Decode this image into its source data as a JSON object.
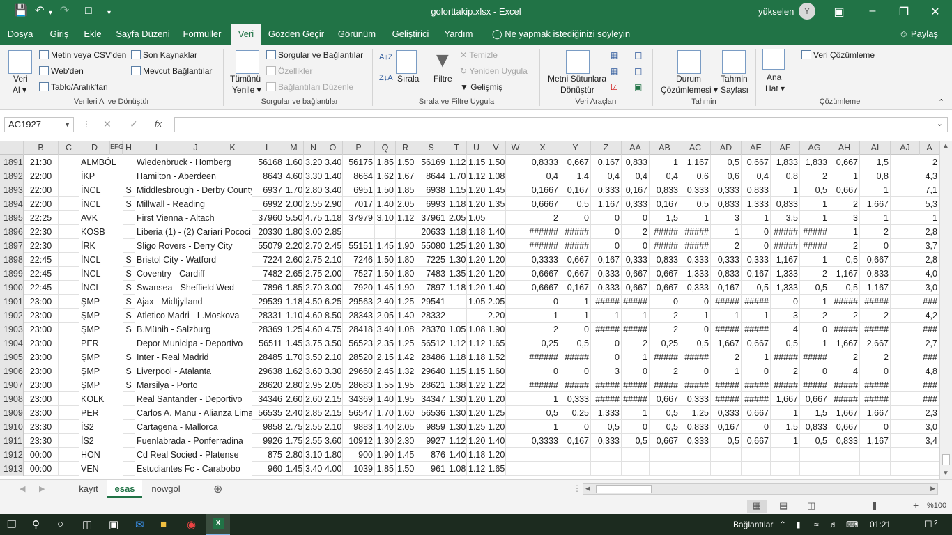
{
  "window": {
    "title": "golorttakip.xlsx  -  Excel",
    "user": "yükselen",
    "avatar_letter": "Y"
  },
  "tabs": [
    "Dosya",
    "Giriş",
    "Ekle",
    "Sayfa Düzeni",
    "Formüller",
    "Veri",
    "Gözden Geçir",
    "Görünüm",
    "Geliştirici",
    "Yardım"
  ],
  "active_tab": "Veri",
  "tell_me": "Ne yapmak istediğinizi söyleyin",
  "share": "Paylaş",
  "ribbon": {
    "get_data": "Veri",
    "get_data2": "Al",
    "from_csv": "Metin veya CSV'den",
    "from_web": "Web'den",
    "from_table": "Tablo/Aralık'tan",
    "recent_sources": "Son Kaynaklar",
    "existing_conn": "Mevcut Bağlantılar",
    "group_get": "Verileri Al ve Dönüştür",
    "refresh_all": "Tümünü",
    "refresh_all2": "Yenile",
    "queries_conn": "Sorgular ve Bağlantılar",
    "properties": "Özellikler",
    "edit_links": "Bağlantıları Düzenle",
    "group_queries": "Sorgular ve bağlantılar",
    "sort": "Sırala",
    "filter": "Filtre",
    "clear": "Temizle",
    "reapply": "Yeniden Uygula",
    "advanced": "Gelişmiş",
    "group_sort": "Sırala ve Filtre Uygula",
    "text_to_columns": "Metni Sütunlara",
    "text_to_columns2": "Dönüştür",
    "group_tools": "Veri Araçları",
    "what_if": "Durum",
    "what_if2": "Çözümlemesi",
    "forecast": "Tahmin",
    "forecast2": "Sayfası",
    "group_forecast": "Tahmin",
    "outline": "Ana",
    "outline2": "Hat",
    "data_analysis": "Veri Çözümleme",
    "group_analysis": "Çözümleme"
  },
  "name_box": "AC1927",
  "columns": [
    "B",
    "C",
    "D",
    "E",
    "F",
    "G",
    "H",
    "I",
    "J",
    "K",
    "L",
    "M",
    "N",
    "O",
    "P",
    "Q",
    "R",
    "S",
    "T",
    "U",
    "V",
    "W",
    "X",
    "Y",
    "Z",
    "AA",
    "AB",
    "AC",
    "AD",
    "AE",
    "AF",
    "AG",
    "AH",
    "AI",
    "AJ",
    "A"
  ],
  "rows": [
    {
      "n": "1891",
      "B": "21:30",
      "D": "ALMBÖL",
      "H": "",
      "I": "Wiedenbruck - Homberg",
      "L": "56168",
      "M": "1.60",
      "N": "3.20",
      "O": "3.40",
      "P": "56175",
      "Q": "1.85",
      "R": "1.50",
      "S": "56169",
      "T": "1.12",
      "U": "1.15",
      "V": "1.50",
      "X": "0,8333",
      "Y": "0,667",
      "Z": "0,167",
      "AA": "0,833",
      "AB": "1",
      "AC": "1,167",
      "AD": "0,5",
      "AE": "0,667",
      "AF": "1,833",
      "AG": "1,833",
      "AH": "0,667",
      "AI": "1,5",
      "A": "2"
    },
    {
      "n": "1892",
      "B": "22:00",
      "D": "İKP",
      "H": "",
      "I": "Hamilton - Aberdeen",
      "L": "8643",
      "M": "4.60",
      "N": "3.30",
      "O": "1.40",
      "P": "8664",
      "Q": "1.62",
      "R": "1.67",
      "S": "8644",
      "T": "1.70",
      "U": "1.12",
      "V": "1.08",
      "X": "0,4",
      "Y": "1,4",
      "Z": "0,4",
      "AA": "0,4",
      "AB": "0,4",
      "AC": "0,6",
      "AD": "0,6",
      "AE": "0,4",
      "AF": "0,8",
      "AG": "2",
      "AH": "1",
      "AI": "0,8",
      "A": "4,3"
    },
    {
      "n": "1893",
      "B": "22:00",
      "D": "İNCL",
      "H": "S",
      "I": "Middlesbrough - Derby County",
      "L": "6937",
      "M": "1.70",
      "N": "2.80",
      "O": "3.40",
      "P": "6951",
      "Q": "1.50",
      "R": "1.85",
      "S": "6938",
      "T": "1.15",
      "U": "1.20",
      "V": "1.45",
      "X": "0,1667",
      "Y": "0,167",
      "Z": "0,333",
      "AA": "0,167",
      "AB": "0,833",
      "AC": "0,333",
      "AD": "0,333",
      "AE": "0,833",
      "AF": "1",
      "AG": "0,5",
      "AH": "0,667",
      "AI": "1",
      "A": "7,1"
    },
    {
      "n": "1894",
      "B": "22:00",
      "D": "İNCL",
      "H": "S",
      "I": "Millwall - Reading",
      "L": "6992",
      "M": "2.00",
      "N": "2.55",
      "O": "2.90",
      "P": "7017",
      "Q": "1.40",
      "R": "2.05",
      "S": "6993",
      "T": "1.18",
      "U": "1.20",
      "V": "1.35",
      "X": "0,6667",
      "Y": "0,5",
      "Z": "1,167",
      "AA": "0,333",
      "AB": "0,167",
      "AC": "0,5",
      "AD": "0,833",
      "AE": "1,333",
      "AF": "0,833",
      "AG": "1",
      "AH": "2",
      "AI": "1,667",
      "A": "5,3"
    },
    {
      "n": "1895",
      "B": "22:25",
      "D": "AVK",
      "H": "",
      "I": "First Vienna - Altach",
      "L": "37960",
      "M": "5.50",
      "N": "4.75",
      "O": "1.18",
      "P": "37979",
      "Q": "3.10",
      "R": "1.12",
      "S": "37961",
      "T": "2.05",
      "U": "1.05",
      "V": "",
      "X": "2",
      "Y": "0",
      "Z": "0",
      "AA": "0",
      "AB": "1,5",
      "AC": "1",
      "AD": "3",
      "AE": "1",
      "AF": "3,5",
      "AG": "1",
      "AH": "3",
      "AI": "1",
      "A": "1"
    },
    {
      "n": "1896",
      "B": "22:30",
      "D": "KOSB",
      "H": "",
      "I": "Liberia (1) - (2) Cariari Pococi",
      "L": "20330",
      "M": "1.80",
      "N": "3.00",
      "O": "2.85",
      "P": "",
      "Q": "",
      "R": "",
      "S": "20633",
      "T": "1.18",
      "U": "1.18",
      "V": "1.40",
      "X": "######",
      "Y": "#####",
      "Z": "0",
      "AA": "2",
      "AB": "#####",
      "AC": "#####",
      "AD": "1",
      "AE": "0",
      "AF": "#####",
      "AG": "#####",
      "AH": "1",
      "AI": "2",
      "A": "2,8"
    },
    {
      "n": "1897",
      "B": "22:30",
      "D": "İRK",
      "H": "",
      "I": "Sligo Rovers - Derry City",
      "L": "55079",
      "M": "2.20",
      "N": "2.70",
      "O": "2.45",
      "P": "55151",
      "Q": "1.45",
      "R": "1.90",
      "S": "55080",
      "T": "1.25",
      "U": "1.20",
      "V": "1.30",
      "X": "######",
      "Y": "#####",
      "Z": "0",
      "AA": "0",
      "AB": "#####",
      "AC": "#####",
      "AD": "2",
      "AE": "0",
      "AF": "#####",
      "AG": "#####",
      "AH": "2",
      "AI": "0",
      "A": "3,7"
    },
    {
      "n": "1898",
      "B": "22:45",
      "D": "İNCL",
      "H": "S",
      "I": "Bristol City - Watford",
      "L": "7224",
      "M": "2.60",
      "N": "2.75",
      "O": "2.10",
      "P": "7246",
      "Q": "1.50",
      "R": "1.80",
      "S": "7225",
      "T": "1.30",
      "U": "1.20",
      "V": "1.20",
      "X": "0,3333",
      "Y": "0,667",
      "Z": "0,167",
      "AA": "0,333",
      "AB": "0,833",
      "AC": "0,333",
      "AD": "0,333",
      "AE": "0,333",
      "AF": "1,167",
      "AG": "1",
      "AH": "0,5",
      "AI": "0,667",
      "A": "2,8"
    },
    {
      "n": "1899",
      "B": "22:45",
      "D": "İNCL",
      "H": "S",
      "I": "Coventry - Cardiff",
      "L": "7482",
      "M": "2.65",
      "N": "2.75",
      "O": "2.00",
      "P": "7527",
      "Q": "1.50",
      "R": "1.80",
      "S": "7483",
      "T": "1.35",
      "U": "1.20",
      "V": "1.20",
      "X": "0,6667",
      "Y": "0,667",
      "Z": "0,333",
      "AA": "0,667",
      "AB": "0,667",
      "AC": "1,333",
      "AD": "0,833",
      "AE": "0,167",
      "AF": "1,333",
      "AG": "2",
      "AH": "1,167",
      "AI": "0,833",
      "A": "4,0"
    },
    {
      "n": "1900",
      "B": "22:45",
      "D": "İNCL",
      "H": "S",
      "I": "Swansea - Sheffield Wed",
      "L": "7896",
      "M": "1.85",
      "N": "2.70",
      "O": "3.00",
      "P": "7920",
      "Q": "1.45",
      "R": "1.90",
      "S": "7897",
      "T": "1.18",
      "U": "1.20",
      "V": "1.40",
      "X": "0,6667",
      "Y": "0,167",
      "Z": "0,333",
      "AA": "0,667",
      "AB": "0,667",
      "AC": "0,333",
      "AD": "0,167",
      "AE": "0,5",
      "AF": "1,333",
      "AG": "0,5",
      "AH": "0,5",
      "AI": "1,167",
      "A": "3,0"
    },
    {
      "n": "1901",
      "B": "23:00",
      "D": "ŞMP",
      "H": "S",
      "I": "Ajax - Midtjylland",
      "L": "29539",
      "M": "1.18",
      "N": "4.50",
      "O": "6.25",
      "P": "29563",
      "Q": "2.40",
      "R": "1.25",
      "S": "29541",
      "T": "",
      "U": "1.05",
      "V": "2.05",
      "X": "0",
      "Y": "1",
      "Z": "#####",
      "AA": "#####",
      "AB": "0",
      "AC": "0",
      "AD": "#####",
      "AE": "#####",
      "AF": "0",
      "AG": "1",
      "AH": "#####",
      "AI": "#####",
      "A": "###"
    },
    {
      "n": "1902",
      "B": "23:00",
      "D": "ŞMP",
      "H": "S",
      "I": "Atletico Madri - L.Moskova",
      "L": "28331",
      "M": "1.10",
      "N": "4.60",
      "O": "8.50",
      "P": "28343",
      "Q": "2.05",
      "R": "1.40",
      "S": "28332",
      "T": "",
      "U": "",
      "V": "2.20",
      "X": "1",
      "Y": "1",
      "Z": "1",
      "AA": "1",
      "AB": "2",
      "AC": "1",
      "AD": "1",
      "AE": "1",
      "AF": "3",
      "AG": "2",
      "AH": "2",
      "AI": "2",
      "A": "4,2"
    },
    {
      "n": "1903",
      "B": "23:00",
      "D": "ŞMP",
      "H": "S",
      "I": "B.Münih - Salzburg",
      "L": "28369",
      "M": "1.25",
      "N": "4.60",
      "O": "4.75",
      "P": "28418",
      "Q": "3.40",
      "R": "1.08",
      "S": "28370",
      "T": "1.05",
      "U": "1.08",
      "V": "1.90",
      "X": "2",
      "Y": "0",
      "Z": "#####",
      "AA": "#####",
      "AB": "2",
      "AC": "0",
      "AD": "#####",
      "AE": "#####",
      "AF": "4",
      "AG": "0",
      "AH": "#####",
      "AI": "#####",
      "A": "###"
    },
    {
      "n": "1904",
      "B": "23:00",
      "D": "PER",
      "H": "",
      "I": "Depor Municipa - Deportivo",
      "L": "56511",
      "M": "1.45",
      "N": "3.75",
      "O": "3.50",
      "P": "56523",
      "Q": "2.35",
      "R": "1.25",
      "S": "56512",
      "T": "1.12",
      "U": "1.12",
      "V": "1.65",
      "X": "0,25",
      "Y": "0,5",
      "Z": "0",
      "AA": "2",
      "AB": "0,25",
      "AC": "0,5",
      "AD": "1,667",
      "AE": "0,667",
      "AF": "0,5",
      "AG": "1",
      "AH": "1,667",
      "AI": "2,667",
      "A": "2,7"
    },
    {
      "n": "1905",
      "B": "23:00",
      "D": "ŞMP",
      "H": "S",
      "I": "Inter - Real Madrid",
      "L": "28485",
      "M": "1.70",
      "N": "3.50",
      "O": "2.10",
      "P": "28520",
      "Q": "2.15",
      "R": "1.42",
      "S": "28486",
      "T": "1.18",
      "U": "1.18",
      "V": "1.52",
      "X": "######",
      "Y": "#####",
      "Z": "0",
      "AA": "1",
      "AB": "#####",
      "AC": "#####",
      "AD": "2",
      "AE": "1",
      "AF": "#####",
      "AG": "#####",
      "AH": "2",
      "AI": "2",
      "A": "###"
    },
    {
      "n": "1906",
      "B": "23:00",
      "D": "ŞMP",
      "H": "S",
      "I": "Liverpool - Atalanta",
      "L": "29638",
      "M": "1.62",
      "N": "3.60",
      "O": "3.30",
      "P": "29660",
      "Q": "2.45",
      "R": "1.32",
      "S": "29640",
      "T": "1.15",
      "U": "1.15",
      "V": "1.60",
      "X": "0",
      "Y": "0",
      "Z": "3",
      "AA": "0",
      "AB": "2",
      "AC": "0",
      "AD": "1",
      "AE": "0",
      "AF": "2",
      "AG": "0",
      "AH": "4",
      "AI": "0",
      "A": "4,8"
    },
    {
      "n": "1907",
      "B": "23:00",
      "D": "ŞMP",
      "H": "S",
      "I": "Marsilya - Porto",
      "L": "28620",
      "M": "2.80",
      "N": "2.95",
      "O": "2.05",
      "P": "28683",
      "Q": "1.55",
      "R": "1.95",
      "S": "28621",
      "T": "1.38",
      "U": "1.22",
      "V": "1.22",
      "X": "######",
      "Y": "#####",
      "Z": "#####",
      "AA": "#####",
      "AB": "#####",
      "AC": "#####",
      "AD": "#####",
      "AE": "#####",
      "AF": "#####",
      "AG": "#####",
      "AH": "#####",
      "AI": "#####",
      "A": "###"
    },
    {
      "n": "1908",
      "B": "23:00",
      "D": "KOLK",
      "H": "",
      "I": "Real Santander - Deportivo",
      "L": "34346",
      "M": "2.60",
      "N": "2.60",
      "O": "2.15",
      "P": "34369",
      "Q": "1.40",
      "R": "1.95",
      "S": "34347",
      "T": "1.30",
      "U": "1.20",
      "V": "1.20",
      "X": "1",
      "Y": "0,333",
      "Z": "#####",
      "AA": "#####",
      "AB": "0,667",
      "AC": "0,333",
      "AD": "#####",
      "AE": "#####",
      "AF": "1,667",
      "AG": "0,667",
      "AH": "#####",
      "AI": "#####",
      "A": "###"
    },
    {
      "n": "1909",
      "B": "23:00",
      "D": "PER",
      "H": "",
      "I": "Carlos A. Manu - Alianza Lima",
      "L": "56535",
      "M": "2.40",
      "N": "2.85",
      "O": "2.15",
      "P": "56547",
      "Q": "1.70",
      "R": "1.60",
      "S": "56536",
      "T": "1.30",
      "U": "1.20",
      "V": "1.25",
      "X": "0,5",
      "Y": "0,25",
      "Z": "1,333",
      "AA": "1",
      "AB": "0,5",
      "AC": "1,25",
      "AD": "0,333",
      "AE": "0,667",
      "AF": "1",
      "AG": "1,5",
      "AH": "1,667",
      "AI": "1,667",
      "A": "2,3"
    },
    {
      "n": "1910",
      "B": "23:30",
      "D": "İS2",
      "H": "",
      "I": "Cartagena - Mallorca",
      "L": "9858",
      "M": "2.75",
      "N": "2.55",
      "O": "2.10",
      "P": "9883",
      "Q": "1.40",
      "R": "2.05",
      "S": "9859",
      "T": "1.30",
      "U": "1.25",
      "V": "1.20",
      "X": "1",
      "Y": "0",
      "Z": "0,5",
      "AA": "0",
      "AB": "0,5",
      "AC": "0,833",
      "AD": "0,167",
      "AE": "0",
      "AF": "1,5",
      "AG": "0,833",
      "AH": "0,667",
      "AI": "0",
      "A": "3,0"
    },
    {
      "n": "1911",
      "B": "23:30",
      "D": "İS2",
      "H": "",
      "I": "Fuenlabrada - Ponferradina",
      "L": "9926",
      "M": "1.75",
      "N": "2.55",
      "O": "3.60",
      "P": "10912",
      "Q": "1.30",
      "R": "2.30",
      "S": "9927",
      "T": "1.12",
      "U": "1.20",
      "V": "1.40",
      "X": "0,3333",
      "Y": "0,167",
      "Z": "0,333",
      "AA": "0,5",
      "AB": "0,667",
      "AC": "0,333",
      "AD": "0,5",
      "AE": "0,667",
      "AF": "1",
      "AG": "0,5",
      "AH": "0,833",
      "AI": "1,167",
      "A": "3,4"
    },
    {
      "n": "1912",
      "B": "00:00",
      "D": "HON",
      "H": "",
      "I": "Cd Real Socied - Platense",
      "L": "875",
      "M": "2.80",
      "N": "3.10",
      "O": "1.80",
      "P": "900",
      "Q": "1.90",
      "R": "1.45",
      "S": "876",
      "T": "1.40",
      "U": "1.18",
      "V": "1.20",
      "X": "",
      "Y": "",
      "Z": "",
      "AA": "",
      "AB": "",
      "AC": "",
      "AD": "",
      "AE": "",
      "AF": "",
      "AG": "",
      "AH": "",
      "AI": "",
      "A": ""
    },
    {
      "n": "1913",
      "B": "00:00",
      "D": "VEN",
      "H": "",
      "I": "Estudiantes Fc - Carabobo",
      "L": "960",
      "M": "1.45",
      "N": "3.40",
      "O": "4.00",
      "P": "1039",
      "Q": "1.85",
      "R": "1.50",
      "S": "961",
      "T": "1.08",
      "U": "1.12",
      "V": "1.65",
      "X": "",
      "Y": "",
      "Z": "",
      "AA": "",
      "AB": "",
      "AC": "",
      "AD": "",
      "AE": "",
      "AF": "",
      "AG": "",
      "AH": "",
      "AI": "",
      "A": ""
    }
  ],
  "sheets": [
    "kayıt",
    "esas",
    "nowgol"
  ],
  "active_sheet": "esas",
  "zoom": "%100",
  "taskbar": {
    "network": "Bağlantılar",
    "time": "01:21",
    "notifications": "2"
  }
}
